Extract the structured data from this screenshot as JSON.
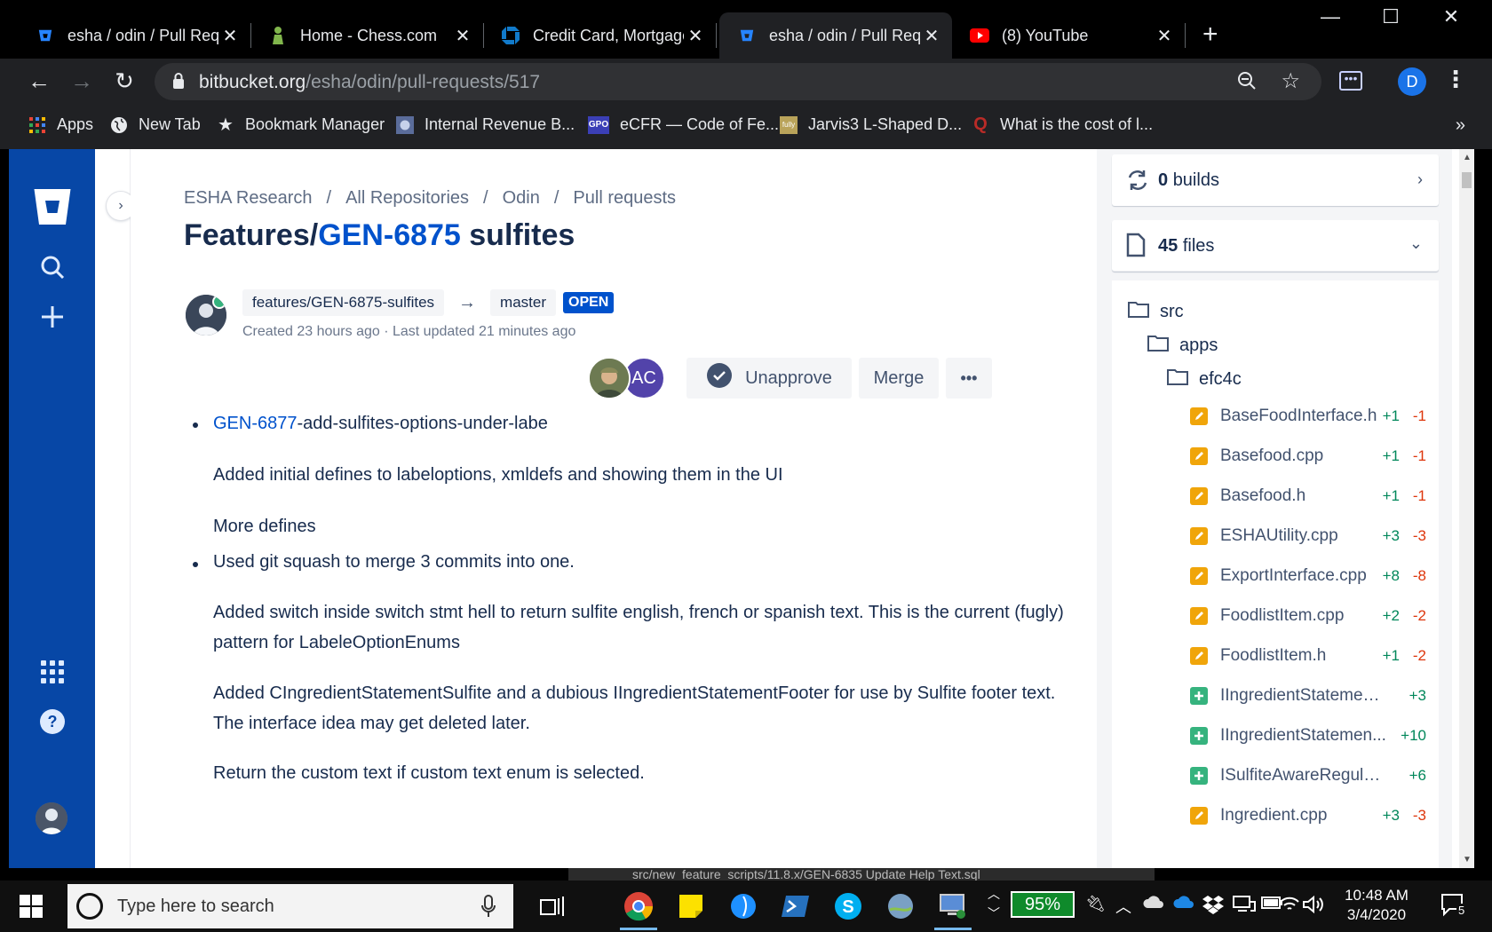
{
  "browser": {
    "tabs": [
      {
        "title": "esha / odin / Pull Requests",
        "icon": "bitbucket-favicon"
      },
      {
        "title": "Home - Chess.com",
        "icon": "chess-pawn-favicon"
      },
      {
        "title": "Credit Card, Mortgage",
        "icon": "chase-favicon"
      },
      {
        "title": "esha / odin / Pull Requests",
        "icon": "bitbucket-favicon",
        "active": true
      },
      {
        "title": "(8) YouTube",
        "icon": "youtube-favicon"
      }
    ],
    "window_controls": {
      "minimize": "—",
      "maximize": "☐",
      "close": "✕"
    },
    "url_domain": "bitbucket.org",
    "url_path": "/esha/odin/pull-requests/517",
    "profile_initial": "D"
  },
  "bookmarks": [
    {
      "label": "Apps",
      "icon": "apps-grid-icon"
    },
    {
      "label": "New Tab",
      "icon": "globe-icon"
    },
    {
      "label": "Bookmark Manager",
      "icon": "star-icon"
    },
    {
      "label": "Internal Revenue B...",
      "icon": "irs-favicon"
    },
    {
      "label": "eCFR — Code of Fe...",
      "icon": "gpo-favicon"
    },
    {
      "label": "Jarvis3 L-Shaped D...",
      "icon": "fully-favicon"
    },
    {
      "label": "What is the cost of l...",
      "icon": "quora-favicon"
    }
  ],
  "bookmarks_more": "»",
  "breadcrumbs": [
    "ESHA Research",
    "All Repositories",
    "Odin",
    "Pull requests"
  ],
  "breadcrumb_sep": "/",
  "pr": {
    "title_prefix": "Features/",
    "title_link": "GEN-6875",
    "title_suffix": " sulfites",
    "source_branch": "features/GEN-6875-sulfites",
    "target_branch": "master",
    "status": "OPEN",
    "meta": "Created 23 hours ago · Last updated 21 minutes ago",
    "reviewer_initials": "AC",
    "actions": {
      "unapprove": "Unapprove",
      "merge": "Merge",
      "more": "•••"
    }
  },
  "description": {
    "item1_link": "GEN-6877",
    "item1_rest": "-add-sulfites-options-under-labe",
    "p1": "Added initial defines to labeloptions, xmldefs and showing them in the UI",
    "p2": "More defines",
    "item2": "Used git squash to merge 3 commits into one.",
    "p3": "Added switch inside switch stmt hell to return sulfite english, french or spanish text. This is the current (fugly) pattern for LabeleOptionEnums",
    "p4": "Added CIngredientStatementSulfite and a dubious IIngredientStatementFooter for use by Sulfite footer text. The interface idea may get deleted later.",
    "p5": "Return the custom text if custom text enum is selected."
  },
  "sidebar": {
    "builds_count": "0",
    "builds_label": "builds",
    "files_count": "45",
    "files_label": "files",
    "folders": [
      "src",
      "apps",
      "efc4c"
    ],
    "files": [
      {
        "name": "BaseFoodInterface.h",
        "adds": "+1",
        "dels": "-1",
        "kind": "modified"
      },
      {
        "name": "Basefood.cpp",
        "adds": "+1",
        "dels": "-1",
        "kind": "modified"
      },
      {
        "name": "Basefood.h",
        "adds": "+1",
        "dels": "-1",
        "kind": "modified"
      },
      {
        "name": "ESHAUtility.cpp",
        "adds": "+3",
        "dels": "-3",
        "kind": "modified"
      },
      {
        "name": "ExportInterface.cpp",
        "adds": "+8",
        "dels": "-8",
        "kind": "modified"
      },
      {
        "name": "FoodlistItem.cpp",
        "adds": "+2",
        "dels": "-2",
        "kind": "modified"
      },
      {
        "name": "FoodlistItem.h",
        "adds": "+1",
        "dels": "-2",
        "kind": "modified"
      },
      {
        "name": "IIngredientStatement...",
        "adds": "+3",
        "dels": "",
        "kind": "added"
      },
      {
        "name": "IIngredientStatemen...",
        "adds": "+10",
        "dels": "",
        "kind": "added"
      },
      {
        "name": "ISulfiteAwareRegulati...",
        "adds": "+6",
        "dels": "",
        "kind": "added"
      },
      {
        "name": "Ingredient.cpp",
        "adds": "+3",
        "dels": "-3",
        "kind": "modified"
      }
    ]
  },
  "peek_text": "src/new_feature_scripts/11.8.x/GEN-6835 Update Help Text.sql",
  "taskbar": {
    "search_placeholder": "Type here to search",
    "battery": "95%",
    "time": "10:48 AM",
    "date": "3/4/2020",
    "notifications": "5"
  },
  "colors": {
    "brand": "#0747a6",
    "link": "#0052cc",
    "add": "#00875a",
    "del": "#de350b",
    "modified": "#f0a50a",
    "added": "#36b37e"
  }
}
